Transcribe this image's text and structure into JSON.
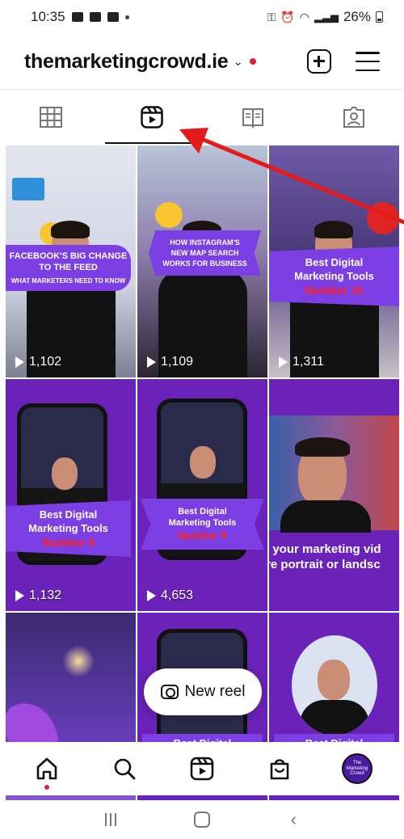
{
  "status_bar": {
    "time": "10:35",
    "battery": "26%"
  },
  "header": {
    "account_name": "themarketingcrowd.ie",
    "chevron": "⌄"
  },
  "tabs": [
    {
      "icon": "grid-icon",
      "active": false
    },
    {
      "icon": "reels-icon",
      "active": true
    },
    {
      "icon": "guides-icon",
      "active": false
    },
    {
      "icon": "tagged-icon",
      "active": false
    }
  ],
  "reels": [
    {
      "views": "1,102",
      "banner_line1": "FACEBOOK'S BIG CHANGE",
      "banner_line2": "TO THE FEED",
      "banner_line3": "WHAT MARKETERS NEED TO KNOW"
    },
    {
      "views": "1,109",
      "banner_line1": "HOW INSTAGRAM'S",
      "banner_line2": "NEW MAP SEARCH",
      "banner_line3": "WORKS FOR BUSINESS"
    },
    {
      "views": "1,311",
      "banner_line1": "Best Digital",
      "banner_line2": "Marketing Tools",
      "banner_line3": "Number 10"
    },
    {
      "views": "1,132",
      "banner_line1": "Best Digital",
      "banner_line2": "Marketing Tools",
      "banner_line3": "Number 9"
    },
    {
      "views": "4,653",
      "banner_line1": "Best Digital",
      "banner_line2": "Marketing Tools",
      "banner_line3": "Number 8"
    },
    {
      "views": "",
      "banner_line1": "l your marketing vid",
      "banner_line2": "re portrait or landsc",
      "banner_line3": ""
    },
    {
      "views": "",
      "banner_line1": "",
      "banner_line2": "",
      "banner_line3": ""
    },
    {
      "views": "",
      "banner_line1": "Best Digital",
      "banner_line2": "",
      "banner_line3": ""
    },
    {
      "views": "",
      "banner_line1": "Best Digital",
      "banner_line2": "",
      "banner_line3": ""
    }
  ],
  "new_reel_button": {
    "label": "New reel"
  },
  "avatar_text": "The Marketing Crowd",
  "colors": {
    "brand_purple": "#6a22b8",
    "banner_purple": "#7b3fe4",
    "accent_red": "#e0243b",
    "arrow_red": "#e31b1b"
  }
}
